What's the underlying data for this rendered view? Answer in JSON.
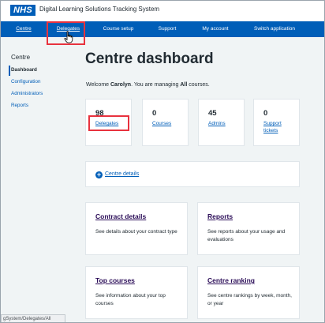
{
  "header": {
    "logo_text": "NHS",
    "app_title": "Digital Learning Solutions Tracking System"
  },
  "nav": {
    "items": [
      "Centre",
      "Delegates",
      "Course setup",
      "Support",
      "My account",
      "Switch application"
    ]
  },
  "sidebar": {
    "heading": "Centre",
    "items": [
      "Dashboard",
      "Configuration",
      "Administrators",
      "Reports"
    ]
  },
  "main": {
    "title": "Centre dashboard",
    "welcome_prefix": "Welcome ",
    "user_name": "Carolyn",
    "welcome_middle": ". You are managing ",
    "scope": "All",
    "welcome_suffix": " courses.",
    "stats": [
      {
        "value": "98",
        "label": "Delegates"
      },
      {
        "value": "0",
        "label": "Courses"
      },
      {
        "value": "45",
        "label": "Admins"
      },
      {
        "value": "0",
        "label": "Support tickets"
      }
    ],
    "centre_details_link": "Centre details",
    "cards": [
      {
        "title": "Contract details",
        "desc": "See details about your contract type"
      },
      {
        "title": "Reports",
        "desc": "See reports about your usage and evaluations"
      },
      {
        "title": "Top courses",
        "desc": "See information about your top courses"
      },
      {
        "title": "Centre ranking",
        "desc": "See centre rankings by week, month, or year"
      }
    ]
  },
  "status_bar": {
    "url": "gSystem/Delegates/All"
  },
  "colors": {
    "nhs_blue": "#005eb8",
    "highlight_red": "#e8323e",
    "card_title_purple": "#2b0d58"
  }
}
